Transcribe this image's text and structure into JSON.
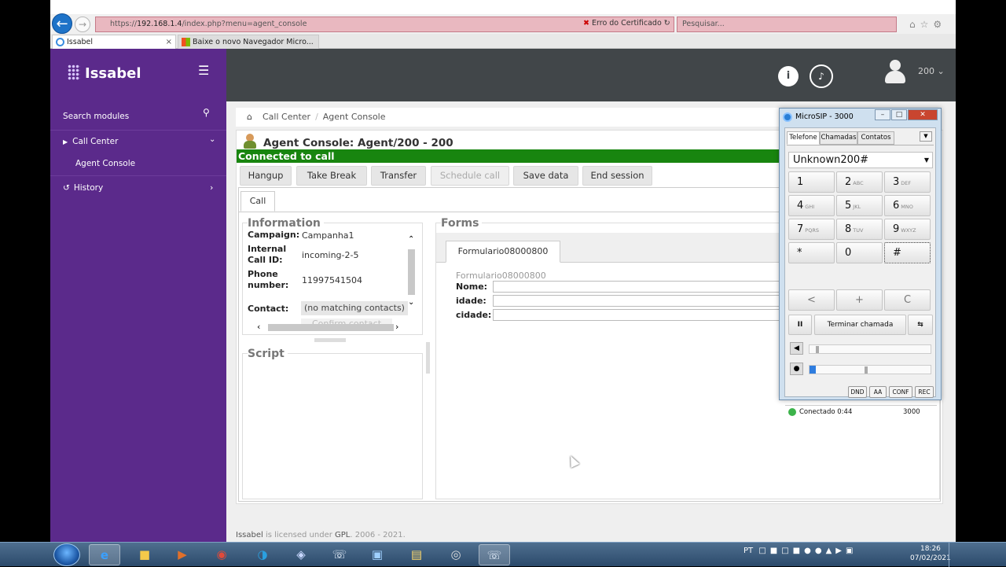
{
  "browser": {
    "url_prefix": "https://",
    "url_host": "192.168.1.4",
    "url_path": "/index.php?menu=agent_console",
    "cert_error": "Erro do Certificado",
    "search_placeholder": "Pesquisar...",
    "tabs": [
      {
        "label": "Issabel"
      },
      {
        "label": "Baixe o novo Navegador Micro..."
      }
    ]
  },
  "sidebar": {
    "brand": "Issabel",
    "search_label": "Search modules",
    "items": [
      {
        "label": "Call Center"
      },
      {
        "label": "Agent Console"
      },
      {
        "label": "History"
      }
    ]
  },
  "header": {
    "user": "200"
  },
  "breadcrumb": {
    "items": [
      "Call Center",
      "Agent Console"
    ]
  },
  "agent": {
    "title": "Agent Console: Agent/200 - 200",
    "status": "Connected to call",
    "buttons": {
      "hangup": "Hangup",
      "take_break": "Take Break",
      "transfer": "Transfer",
      "schedule_call": "Schedule call",
      "save_data": "Save data",
      "end_session": "End session"
    },
    "tab_call": "Call"
  },
  "information": {
    "legend": "Information",
    "campaign_label": "Campaign:",
    "campaign": "Campanha1",
    "call_id_label_1": "Internal",
    "call_id_label_2": "Call ID:",
    "call_id": "incoming-2-5",
    "phone_label_1": "Phone",
    "phone_label_2": "number:",
    "phone": "11997541504",
    "contact_label": "Contact:",
    "contact": "(no matching contacts)",
    "confirm": "Confirm contact"
  },
  "script": {
    "legend": "Script"
  },
  "forms": {
    "legend": "Forms",
    "tab": "Formulario08000800",
    "form_title": "Formulario08000800",
    "fields": [
      {
        "label": "Nome:"
      },
      {
        "label": "idade:"
      },
      {
        "label": "cidade:"
      }
    ]
  },
  "footer": {
    "brand": "Issabel",
    "text_mid": " is licensed under ",
    "license": "GPL",
    "years": ". 2006 - 2021."
  },
  "microsip": {
    "title": "MicroSIP - 3000",
    "tabs": [
      "Telefone",
      "Chamadas",
      "Contatos"
    ],
    "dial_value": "Unknown200#",
    "keys": [
      {
        "main": "1",
        "sub": ""
      },
      {
        "main": "2",
        "sub": "ABC"
      },
      {
        "main": "3",
        "sub": "DEF"
      },
      {
        "main": "4",
        "sub": "GHI"
      },
      {
        "main": "5",
        "sub": "JKL"
      },
      {
        "main": "6",
        "sub": "MNO"
      },
      {
        "main": "7",
        "sub": "PQRS"
      },
      {
        "main": "8",
        "sub": "TUV"
      },
      {
        "main": "9",
        "sub": "WXYZ"
      },
      {
        "main": "*",
        "sub": ""
      },
      {
        "main": "0",
        "sub": ""
      },
      {
        "main": "#",
        "sub": ""
      }
    ],
    "backspace": "<",
    "plus": "+",
    "clear": "C",
    "hold": "II",
    "end_call": "Terminar chamada",
    "transfer_icon": "transfer-icon",
    "speaker_level": 0.05,
    "mic_level": 0.05,
    "buttons": [
      "DND",
      "AA",
      "CONF",
      "REC"
    ],
    "status": "Conectado 0:44",
    "account": "3000"
  },
  "taskbar": {
    "lang": "PT",
    "time": "18:26",
    "date": "07/02/2021"
  }
}
